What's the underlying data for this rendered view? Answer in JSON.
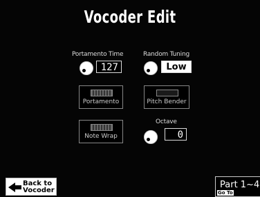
{
  "title": "Vocoder Edit",
  "portamento_time": {
    "label": "Portamento Time",
    "value": "127"
  },
  "random_tuning": {
    "label": "Random Tuning",
    "value": "Low"
  },
  "switches": {
    "portamento": {
      "label": "Portamento",
      "state": "on"
    },
    "pitch_bender": {
      "label": "Pitch Bender",
      "state": "off"
    },
    "note_wrap": {
      "label": "Note Wrap",
      "state": "on"
    }
  },
  "octave": {
    "label": "Octave",
    "value": "0"
  },
  "back_button": {
    "line1": "Back to",
    "line2": "Vocoder"
  },
  "part_button": {
    "label": "Part 1~4",
    "sub": "Go To"
  }
}
